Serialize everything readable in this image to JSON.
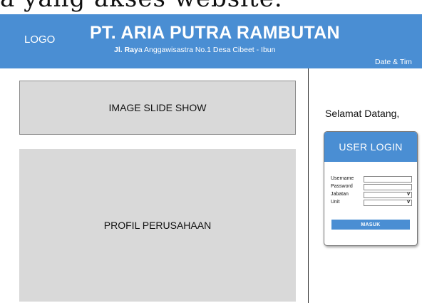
{
  "top_strip": {
    "text": "a yang akses website."
  },
  "header": {
    "logo": "LOGO",
    "company": "PT. ARIA PUTRA RAMBUTAN",
    "address_bold": "Jl. Ray",
    "address_rest": "a Anggawisastra No.1 Desa Cibeet - Ibun",
    "datetime": "Date & Tim"
  },
  "left": {
    "slideshow_label": "IMAGE SLIDE SHOW",
    "profile_label": "PROFIL PERUSAHAAN"
  },
  "right": {
    "welcome": "Selamat Datang,",
    "login": {
      "title": "USER LOGIN",
      "username_label": "Username",
      "password_label": "Password",
      "jabatan_label": "Jabatan",
      "unit_label": "Unit",
      "dropdown_glyph": "v",
      "submit_label": "MASUK"
    }
  },
  "colors": {
    "accent": "#4a8ed3",
    "panel": "#d9d9d9"
  }
}
